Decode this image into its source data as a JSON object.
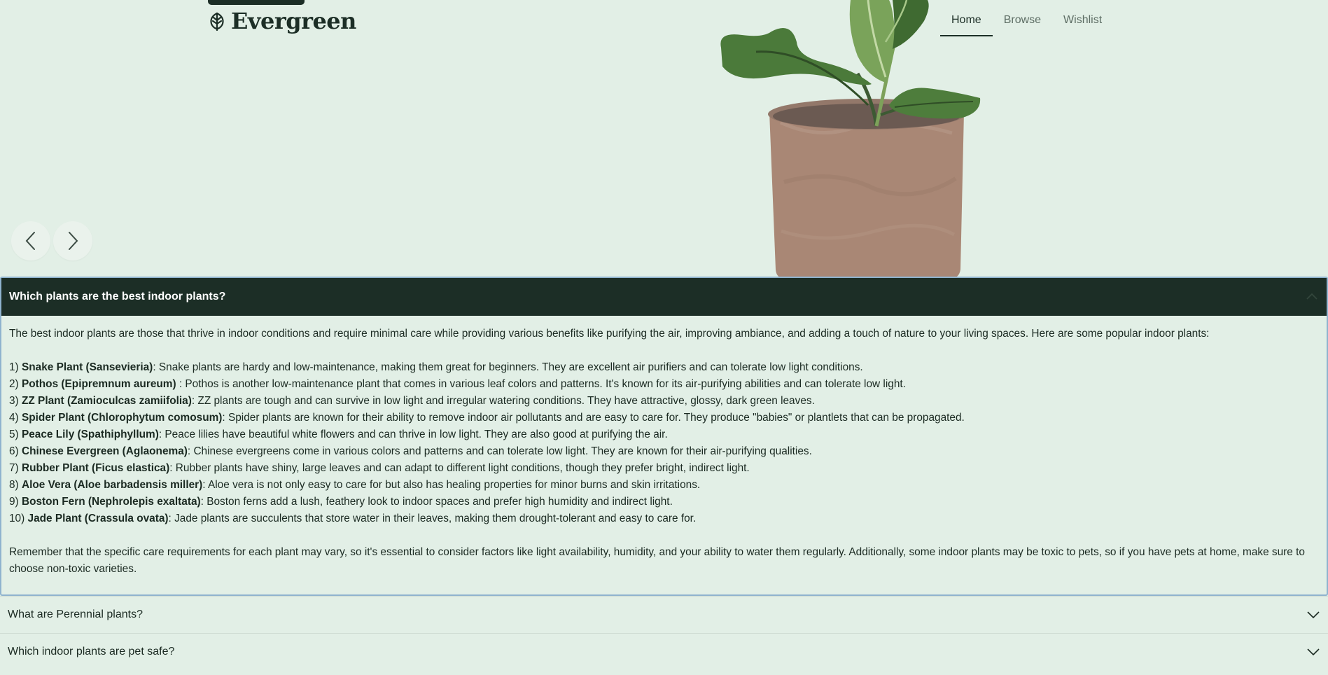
{
  "brand": {
    "name": "Evergreen",
    "logo_icon": "leaf-icon"
  },
  "nav": {
    "items": [
      {
        "label": "Home",
        "active": true
      },
      {
        "label": "Browse",
        "active": false
      },
      {
        "label": "Wishlist",
        "active": false
      }
    ]
  },
  "carousel": {
    "prev_icon": "chevron-left-icon",
    "next_icon": "chevron-right-icon"
  },
  "colors": {
    "background": "#e2efe6",
    "dark": "#1c2e26",
    "accent_border": "#8fb3ce"
  },
  "faq": {
    "open": {
      "question": "Which plants are the best indoor plants?",
      "intro": "The best indoor plants are those that thrive in indoor conditions and require minimal care while providing various benefits like purifying the air, improving ambiance, and adding a touch of nature to your living spaces. Here are some popular indoor plants:",
      "plants": [
        {
          "num": "1)",
          "name": "Snake Plant (Sansevieria)",
          "desc": ": Snake plants are hardy and low-maintenance, making them great for beginners. They are excellent air purifiers and can tolerate low light conditions."
        },
        {
          "num": "2)",
          "name": "Pothos (Epipremnum aureum)",
          "desc": " : Pothos is another low-maintenance plant that comes in various leaf colors and patterns. It's known for its air-purifying abilities and can tolerate low light."
        },
        {
          "num": "3)",
          "name": "ZZ Plant (Zamioculcas zamiifolia)",
          "desc": ": ZZ plants are tough and can survive in low light and irregular watering conditions. They have attractive, glossy, dark green leaves."
        },
        {
          "num": "4)",
          "name": "Spider Plant (Chlorophytum comosum)",
          "desc": ": Spider plants are known for their ability to remove indoor air pollutants and are easy to care for. They produce \"babies\" or plantlets that can be propagated."
        },
        {
          "num": "5)",
          "name": "Peace Lily (Spathiphyllum)",
          "desc": ": Peace lilies have beautiful white flowers and can thrive in low light. They are also good at purifying the air."
        },
        {
          "num": "6)",
          "name": "Chinese Evergreen (Aglaonema)",
          "desc": ": Chinese evergreens come in various colors and patterns and can tolerate low light. They are known for their air-purifying qualities."
        },
        {
          "num": "7)",
          "name": "Rubber Plant (Ficus elastica)",
          "desc": ": Rubber plants have shiny, large leaves and can adapt to different light conditions, though they prefer bright, indirect light."
        },
        {
          "num": "8)",
          "name": "Aloe Vera (Aloe barbadensis miller)",
          "desc": ": Aloe vera is not only easy to care for but also has healing properties for minor burns and skin irritations."
        },
        {
          "num": "9)",
          "name": "Boston Fern (Nephrolepis exaltata)",
          "desc": ": Boston ferns add a lush, feathery look to indoor spaces and prefer high humidity and indirect light."
        },
        {
          "num": "10)",
          "name": "Jade Plant (Crassula ovata)",
          "desc": ": Jade plants are succulents that store water in their leaves, making them drought-tolerant and easy to care for."
        }
      ],
      "outro": "Remember that the specific care requirements for each plant may vary, so it's essential to consider factors like light availability, humidity, and your ability to water them regularly. Additionally, some indoor plants may be toxic to pets, so if you have pets at home, make sure to choose non-toxic varieties."
    },
    "collapsed": [
      {
        "question": "What are Perennial plants?",
        "icon": "chevron-down-icon"
      },
      {
        "question": "Which indoor plants are pet safe?",
        "icon": "chevron-down-icon"
      }
    ]
  }
}
